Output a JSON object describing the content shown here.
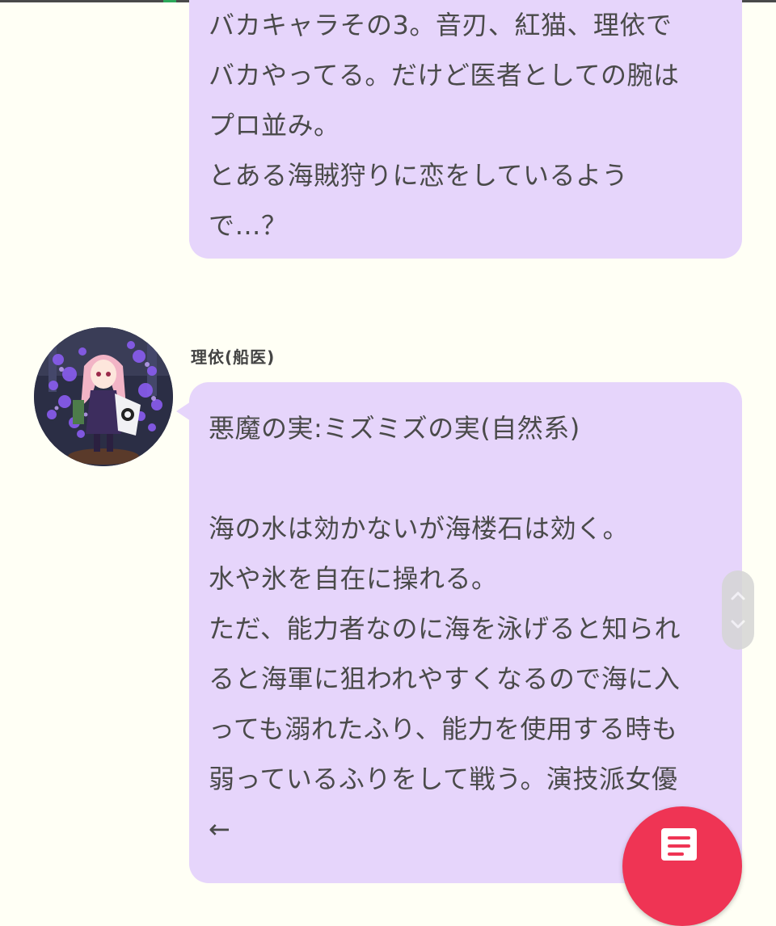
{
  "colors": {
    "background": "#fffff5",
    "bubble": "#e6d5fb",
    "text": "#4a4a4a",
    "fab": "#ef3454",
    "scrollbar": "#d5d5d5"
  },
  "messages": [
    {
      "sender": "",
      "lines": [
        "バカキャラその3。音刃、紅猫、理依で",
        "バカやってる。だけど医者としての腕は",
        "プロ並み。",
        "とある海賊狩りに恋をしているよう",
        "で…？"
      ]
    },
    {
      "sender": "理依(船医)",
      "avatar_icon": "avatar-illustration",
      "lines": [
        "悪魔の実:ミズミズの実(自然系)",
        "",
        "海の水は効かないが海楼石は効く。",
        "水や氷を自在に操れる。",
        "ただ、能力者なのに海を泳げると知られ",
        "ると海軍に狙われやすくなるので海に入",
        "っても溺れたふり、能力を使用する時も",
        "弱っているふりをして戦う。演技派女優",
        "←"
      ]
    }
  ],
  "scroll_control": {
    "up_icon": "chevron-up-icon",
    "down_icon": "chevron-down-icon"
  },
  "fab": {
    "icon": "document-icon"
  }
}
